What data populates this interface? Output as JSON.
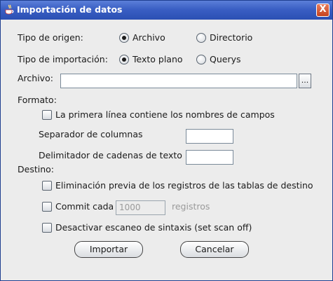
{
  "window": {
    "title": "Importación de datos",
    "close_glyph": "X"
  },
  "origin": {
    "label": "Tipo de origen:",
    "options": [
      "Archivo",
      "Directorio"
    ],
    "selected": "Archivo"
  },
  "import_type": {
    "label": "Tipo de importación:",
    "options": [
      "Texto plano",
      "Querys"
    ],
    "selected": "Texto plano"
  },
  "file": {
    "label": "Archivo:",
    "value": "",
    "browse_label": "..."
  },
  "format": {
    "heading": "Formato:",
    "first_line_checkbox": "La primera línea contiene los nombres de campos",
    "column_separator_label": "Separador de columnas",
    "column_separator_value": "",
    "string_delimiter_label": "Delimitador de cadenas de texto",
    "string_delimiter_value": ""
  },
  "destination": {
    "heading": "Destino:",
    "delete_checkbox": "Eliminación previa de los registros de las tablas de destino",
    "commit_checkbox": "Commit cada",
    "commit_value": "1000",
    "commit_unit": "registros",
    "scan_checkbox": "Desactivar escaneo de sintaxis (set scan off)"
  },
  "buttons": {
    "import": "Importar",
    "cancel": "Cancelar"
  },
  "icons": {
    "title": "java-cup-icon",
    "close": "close-icon"
  },
  "colors": {
    "titlebar": "#3a5fc4",
    "background": "#ececec",
    "close_button": "#d4542f"
  }
}
